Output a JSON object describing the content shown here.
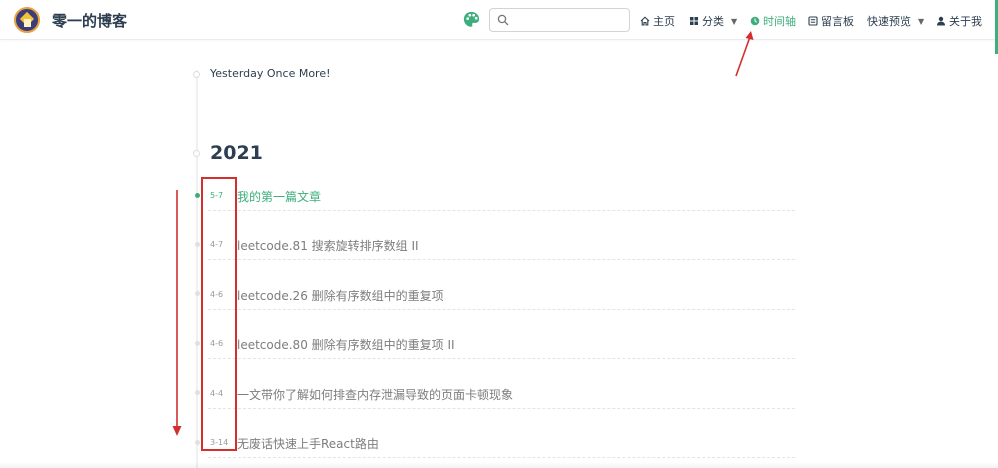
{
  "header": {
    "site_title": "零一的博客",
    "search": {
      "value": "",
      "placeholder": ""
    },
    "nav": [
      {
        "label": "主页",
        "icon": "home-icon",
        "active": false
      },
      {
        "label": "分类",
        "icon": "grid-icon",
        "active": false,
        "dropdown": true
      },
      {
        "label": "时间轴",
        "icon": "clock-icon",
        "active": true
      },
      {
        "label": "留言板",
        "icon": "message-board-icon",
        "active": false
      },
      {
        "label": "快速预览",
        "icon": "",
        "active": false,
        "dropdown": true
      },
      {
        "label": "关于我",
        "icon": "user-icon",
        "active": false
      }
    ]
  },
  "timeline": {
    "description": "Yesterday Once More!",
    "year": "2021",
    "posts": [
      {
        "date": "5-7",
        "title": "我的第一篇文章",
        "active": true
      },
      {
        "date": "4-7",
        "title": "leetcode.81 搜索旋转排序数组 II",
        "active": false
      },
      {
        "date": "4-6",
        "title": "leetcode.26 删除有序数组中的重复项",
        "active": false
      },
      {
        "date": "4-6",
        "title": "leetcode.80 删除有序数组中的重复项 II",
        "active": false
      },
      {
        "date": "4-4",
        "title": "一文带你了解如何排查内存泄漏导致的页面卡顿现象",
        "active": false
      },
      {
        "date": "3-14",
        "title": "无废话快速上手React路由",
        "active": false
      }
    ]
  },
  "colors": {
    "accent": "#3eaf7c",
    "text": "#2c3e50",
    "muted_text": "#7d7d7d",
    "annotation": "#d32f2f",
    "logo_bg": "#3d3c7a",
    "logo_ring": "#e6a23c"
  }
}
